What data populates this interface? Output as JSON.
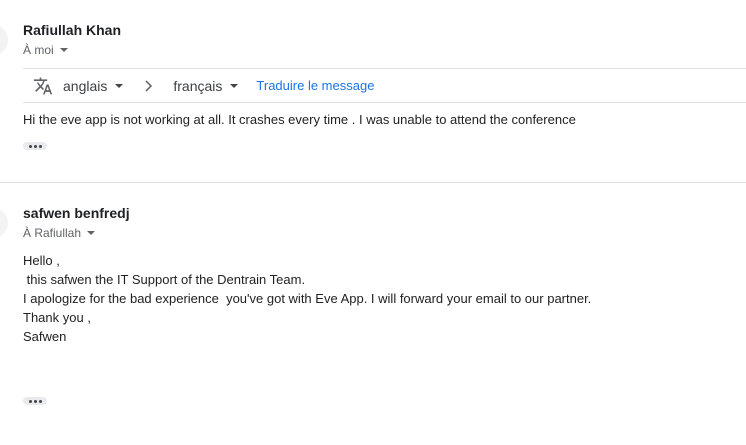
{
  "message1": {
    "sender": "Rafiullah Khan",
    "recipient": "À moi",
    "translate": {
      "from_lang": "anglais",
      "to_lang": "français",
      "action": "Traduire le message"
    },
    "body": "Hi the eve app is not working at all. It crashes every time . I was unable to attend the conference"
  },
  "message2": {
    "sender": "safwen benfredj",
    "recipient": "À Rafiullah",
    "body_lines": [
      "Hello ,",
      " this safwen the IT Support of the Dentrain Team.",
      "I apologize for the bad experience  you've got with Eve App. I will forward your email to our partner.",
      "Thank you ,",
      "Safwen"
    ]
  },
  "colors": {
    "link": "#1a73e8",
    "divider": "#e0e0e0",
    "secondary_text": "#5f6368"
  },
  "icons": [
    "translate-icon",
    "chevron-right-icon",
    "more-horiz-icon",
    "caret-down-icon"
  ]
}
